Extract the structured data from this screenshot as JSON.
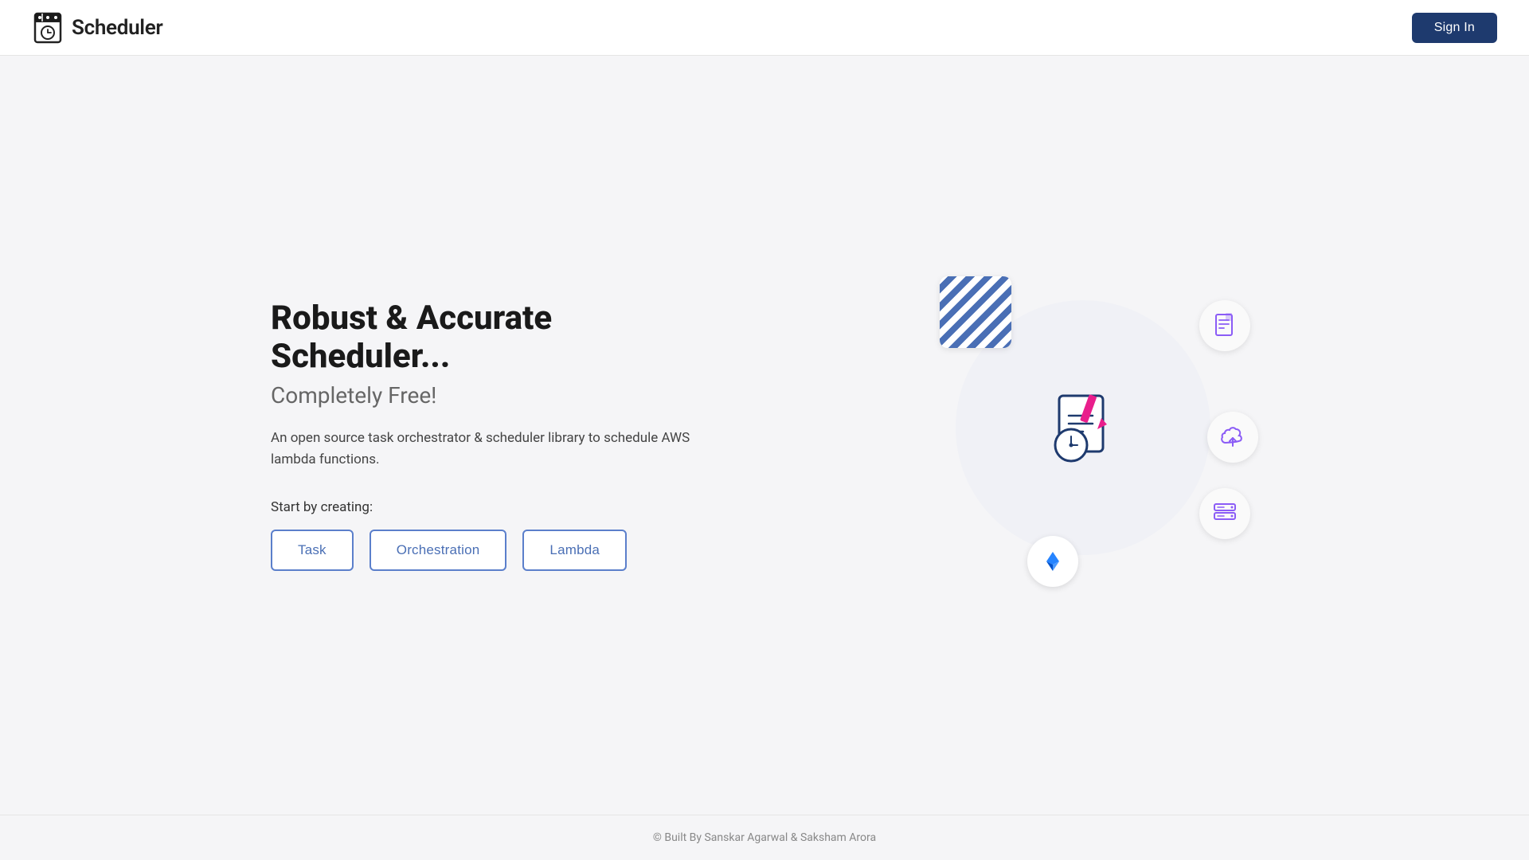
{
  "header": {
    "logo_text": "Scheduler",
    "sign_in_label": "Sign In"
  },
  "hero": {
    "title": "Robust & Accurate Scheduler...",
    "subtitle": "Completely Free!",
    "description": "An open source task orchestrator & scheduler library to schedule AWS lambda functions.",
    "start_label": "Start by creating:",
    "buttons": [
      {
        "label": "Task",
        "key": "task"
      },
      {
        "label": "Orchestration",
        "key": "orchestration"
      },
      {
        "label": "Lambda",
        "key": "lambda"
      }
    ]
  },
  "footer": {
    "text": "© Built By Sanskar Agarwal & Saksham Arora"
  }
}
